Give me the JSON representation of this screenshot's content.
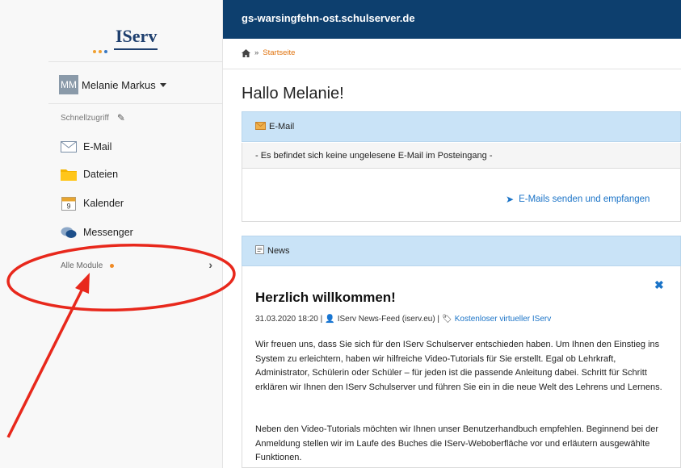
{
  "app": {
    "logo_text": "IServ",
    "server": "gs-warsingfehn-ost.schulserver.de"
  },
  "sidebar": {
    "avatar_initials": "MM",
    "user_name": "Melanie Markus",
    "quick_access": "Schnellzugriff",
    "items": [
      {
        "label": "E-Mail",
        "icon": "mail-icon"
      },
      {
        "label": "Dateien",
        "icon": "folder-icon"
      },
      {
        "label": "Kalender",
        "icon": "calendar-icon",
        "icon_text": "9"
      },
      {
        "label": "Messenger",
        "icon": "chat-bubbles-icon"
      }
    ],
    "all_modules": "Alle Module"
  },
  "breadcrumb": {
    "separator": "»",
    "current": "Startseite"
  },
  "main": {
    "greeting": "Hallo Melanie!",
    "email_panel": {
      "title": "E-Mail",
      "message": "- Es befindet sich keine ungelesene E-Mail im Posteingang -",
      "link": "E-Mails senden und empfangen"
    },
    "news_panel": {
      "title": "News",
      "article_title": "Herzlich willkommen!",
      "date": "31.03.2020 18:20 |",
      "author": "IServ News-Feed (iserv.eu) |",
      "tag": "Kostenloser virtueller IServ",
      "paragraph1": "Wir freuen uns, dass Sie sich für den IServ Schulserver entschieden haben. Um Ihnen den Einstieg ins System zu erleichtern, haben wir hilfreiche Video-Tutorials für Sie erstellt. Egal ob Lehrkraft, Administrator, Schülerin oder Schüler – für jeden ist die passende Anleitung dabei. Schritt für Schritt erklären wir Ihnen den IServ Schulserver und führen Sie ein in die neue Welt des Lehrens und Lernens.",
      "paragraph2": "Neben den Video-Tutorials möchten wir Ihnen unser Benutzerhandbuch empfehlen. Beginnend bei der Anmeldung stellen wir im Laufe des Buches die IServ-Weboberfläche vor und erläutern ausgewählte Funktionen."
    }
  },
  "colors": {
    "header": "#0d3f6e",
    "panel_head": "#c9e3f7",
    "link": "#1a73c7",
    "accent": "#e0730e",
    "annotation": "#e8281c"
  }
}
